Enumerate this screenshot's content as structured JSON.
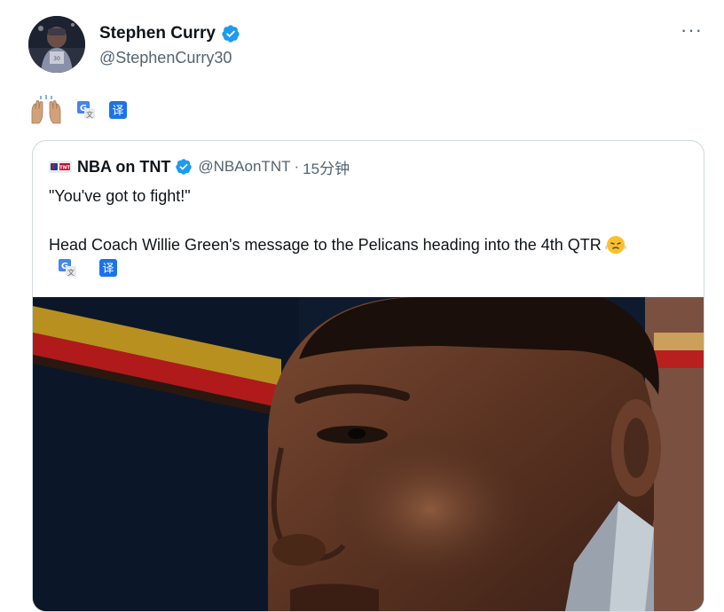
{
  "author": {
    "display_name": "Stephen Curry",
    "handle": "@StephenCurry30",
    "verified": true,
    "avatar_icon": "avatar-photo"
  },
  "tweet": {
    "emoji": "raising-hands-emoji",
    "translate_icons": [
      "google-translate-icon",
      "yi-translate-icon"
    ],
    "more_label": "···"
  },
  "quote": {
    "source_name": "NBA on TNT",
    "handle": "@NBAonTNT",
    "separator": "·",
    "time": "15分钟",
    "text_line_1": "\"You've got to fight!\"",
    "text_line_2": "Head Coach Willie Green's message to the Pelicans heading into the 4th QTR",
    "emoji": "face-with-steam-emoji",
    "translate_icons": [
      "google-translate-icon",
      "yi-translate-icon"
    ],
    "media": "video-still-coach"
  },
  "colors": {
    "verified_blue": "#1d9bf0",
    "secondary_text": "#536471",
    "border": "#cfd9de",
    "primary_text": "#0f1419"
  }
}
